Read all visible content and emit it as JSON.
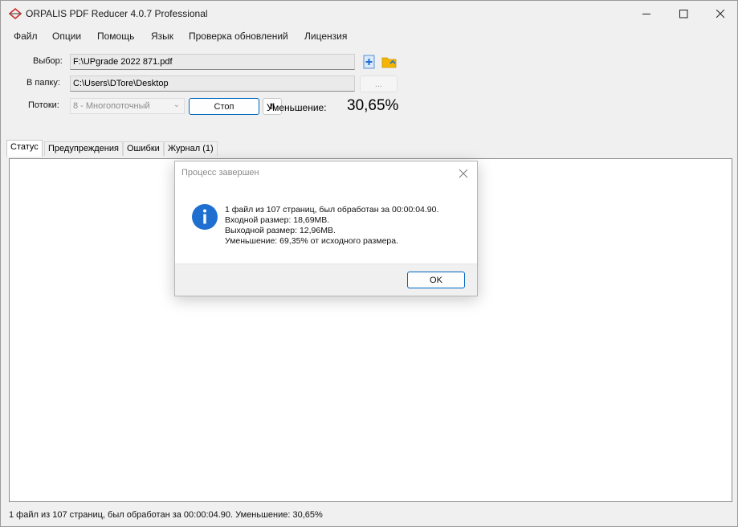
{
  "window": {
    "title": "ORPALIS PDF Reducer 4.0.7 Professional"
  },
  "menu": [
    "Файл",
    "Опции",
    "Помощь",
    "Язык",
    "Проверка обновлений",
    "Лицензия"
  ],
  "form": {
    "source_label": "Выбор:",
    "source_value": "F:\\UPgrade 2022 871.pdf",
    "dest_label": "В папку:",
    "dest_value": "C:\\Users\\DTore\\Desktop",
    "browse_label": "...",
    "threads_label": "Потоки:",
    "threads_value": "8 - Многопоточный",
    "stop_label": "Стоп",
    "pause_label": "II",
    "reduction_label": "Уменьшение:",
    "reduction_value": "30,65%"
  },
  "tabs": [
    "Статус",
    "Предупреждения",
    "Ошибки",
    "Журнал (1)"
  ],
  "status_bar": "1 файл из 107 страниц, был обработан за 00:00:04.90. Уменьшение: 30,65%",
  "dialog": {
    "title": "Процесс завершен",
    "lines": [
      "1 файл из 107 страниц, был обработан за 00:00:04.90.",
      "Входной размер: 18,69MB.",
      "Выходной размер: 12,96MB.",
      "Уменьшение: 69,35% от исходного размера."
    ],
    "ok_label": "OK"
  },
  "colors": {
    "accent": "#0067c0",
    "info_icon": "#1e6fd0"
  }
}
